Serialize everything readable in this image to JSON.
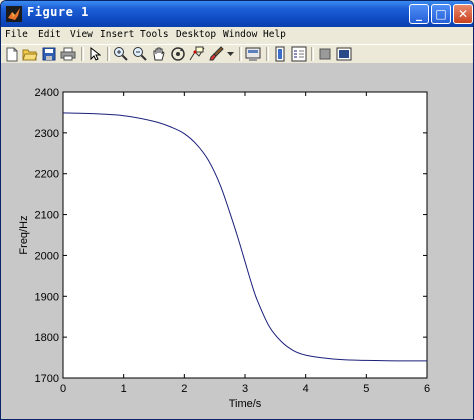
{
  "window": {
    "title": "Figure 1",
    "controls": {
      "minimize": "_",
      "maximize": "□",
      "close": "✕"
    }
  },
  "menu": {
    "items": [
      "File",
      "Edit",
      "View",
      "Insert",
      "Tools",
      "Desktop",
      "Window",
      "Help"
    ]
  },
  "toolbar": {
    "icons": [
      "new-figure-icon",
      "open-file-icon",
      "save-icon",
      "print-icon",
      "edit-plot-arrow-icon",
      "zoom-in-icon",
      "zoom-out-icon",
      "pan-hand-icon",
      "rotate-3d-icon",
      "data-cursor-icon",
      "brush-icon",
      "link-plot-icon",
      "insert-colorbar-icon",
      "insert-legend-icon",
      "hide-plot-tools-icon",
      "show-plot-tools-icon"
    ]
  },
  "colors": {
    "line": "#1b1f7a",
    "figure_background": "#c8c8c8",
    "axes_background": "#ffffff"
  },
  "chart_data": {
    "type": "line",
    "title": "",
    "xlabel": "Time/s",
    "ylabel": "Freq/Hz",
    "xlim": [
      0,
      6
    ],
    "ylim": [
      1700,
      2400
    ],
    "xticks": [
      0,
      1,
      2,
      3,
      4,
      5,
      6
    ],
    "yticks": [
      1700,
      1800,
      1900,
      2000,
      2100,
      2200,
      2300,
      2400
    ],
    "grid": false,
    "legend": "none",
    "x": [
      0,
      0.5,
      1,
      1.5,
      1.8,
      2,
      2.2,
      2.4,
      2.6,
      2.8,
      2.9,
      3,
      3.1,
      3.2,
      3.4,
      3.6,
      3.8,
      4,
      4.3,
      4.6,
      5,
      5.5,
      6
    ],
    "y": [
      2349,
      2347,
      2342,
      2328,
      2313,
      2298,
      2272,
      2232,
      2169,
      2082,
      2035,
      1985,
      1935,
      1891,
      1826,
      1789,
      1767,
      1756,
      1749,
      1745,
      1743,
      1742,
      1742
    ]
  }
}
